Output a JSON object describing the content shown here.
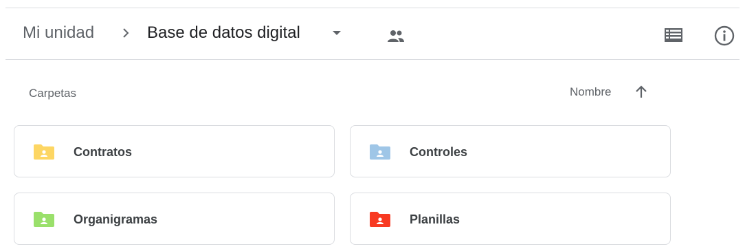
{
  "breadcrumb": {
    "root_label": "Mi unidad",
    "current_label": "Base de datos digital"
  },
  "section": {
    "folders_label": "Carpetas"
  },
  "sort": {
    "label": "Nombre",
    "direction": "ascending"
  },
  "folders": [
    {
      "name": "Contratos",
      "color": "#fdd663"
    },
    {
      "name": "Controles",
      "color": "#9fc6e7"
    },
    {
      "name": "Organigramas",
      "color": "#9ae06b"
    },
    {
      "name": "Planillas",
      "color": "#f83a22"
    }
  ],
  "icons": {
    "separator": "chevron-right-icon",
    "caret": "dropdown-caret-icon",
    "shared": "people-icon",
    "list_view": "list-view-icon",
    "info": "info-icon",
    "sort": "arrow-up-icon",
    "folder": "shared-folder-icon"
  },
  "colors": {
    "text_primary": "#202124",
    "text_secondary": "#5f6368",
    "border": "#dadce0"
  }
}
